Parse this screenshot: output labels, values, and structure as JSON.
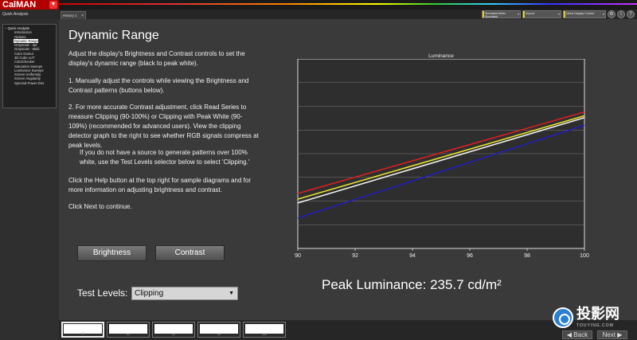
{
  "app": {
    "logo": "CalMAN"
  },
  "sidebar": {
    "header": "Quick Analysis",
    "root": "Quick Analysis",
    "items": [
      "Introduction",
      "Options",
      "Dynamic Range",
      "Grayscale - 2pt",
      "Grayscale - Multi",
      "Color Gamut",
      "3D Cube LUT",
      "ColorChecker",
      "Saturation Sweeps",
      "Luminance Sweeps",
      "Screen Uniformity",
      "Screen Angularity",
      "Spectral Power Dist."
    ],
    "selected_index": 2
  },
  "tabs": [
    {
      "label": "History 1"
    }
  ],
  "toolbar": {
    "meter_dropdown": "Simulated Meter Simulated",
    "source_dropdown": "Source",
    "display_dropdown": "Direct Display Control"
  },
  "page": {
    "title": "Dynamic Range",
    "intro": "Adjust the display's Brightness and Contrast controls to set the display's dynamic range (black to peak white).",
    "step1": "1.  Manually adjust the controls while viewing the Brightness and Contrast patterns (buttons below).",
    "step2": "2.  For more accurate Contrast adjustment, click Read Series to measure Clipping (90-100%) or Clipping with Peak White (90-109%) (recommended for advanced users). View the clipping detector graph to the right to see whether RGB signals compress at peak levels.",
    "step2b": "If you do not have a source to generate patterns over 100% white, use the Test Levels selector below to select 'Clipping.'",
    "help": "Click the Help button at the top right for sample diagrams and for more information on adjusting brightness and contrast.",
    "next": "Click Next to continue.",
    "brightness_button": "Brightness",
    "contrast_button": "Contrast",
    "test_levels_label": "Test Levels:",
    "test_levels_value": "Clipping",
    "peak_luminance": "Peak Luminance: 235.7  cd/m²"
  },
  "chart_data": {
    "type": "line",
    "title": "Luminance",
    "xlim": [
      90,
      100
    ],
    "ylim": [
      0,
      1
    ],
    "x_ticks": [
      "90",
      "92",
      "94",
      "96",
      "98",
      "100"
    ],
    "grid": true,
    "series": [
      {
        "color": "#d42020",
        "x": [
          90,
          100
        ],
        "y": [
          0.29,
          0.72
        ]
      },
      {
        "color": "#e8e030",
        "x": [
          90,
          100
        ],
        "y": [
          0.26,
          0.7
        ]
      },
      {
        "color": "#f0f0f0",
        "x": [
          90,
          100
        ],
        "y": [
          0.24,
          0.69
        ]
      },
      {
        "color": "#2020b8",
        "x": [
          90,
          100
        ],
        "y": [
          0.16,
          0.65
        ]
      }
    ]
  },
  "bottom": {
    "thumbs": [
      "90",
      "91",
      "92",
      "93",
      "100"
    ],
    "selected_thumb": 0,
    "back_label": "Back",
    "next_label": "Next"
  },
  "watermark": {
    "text": "投影网",
    "sub": "TOUYING.COM",
    "color": "#2a7fd0"
  }
}
